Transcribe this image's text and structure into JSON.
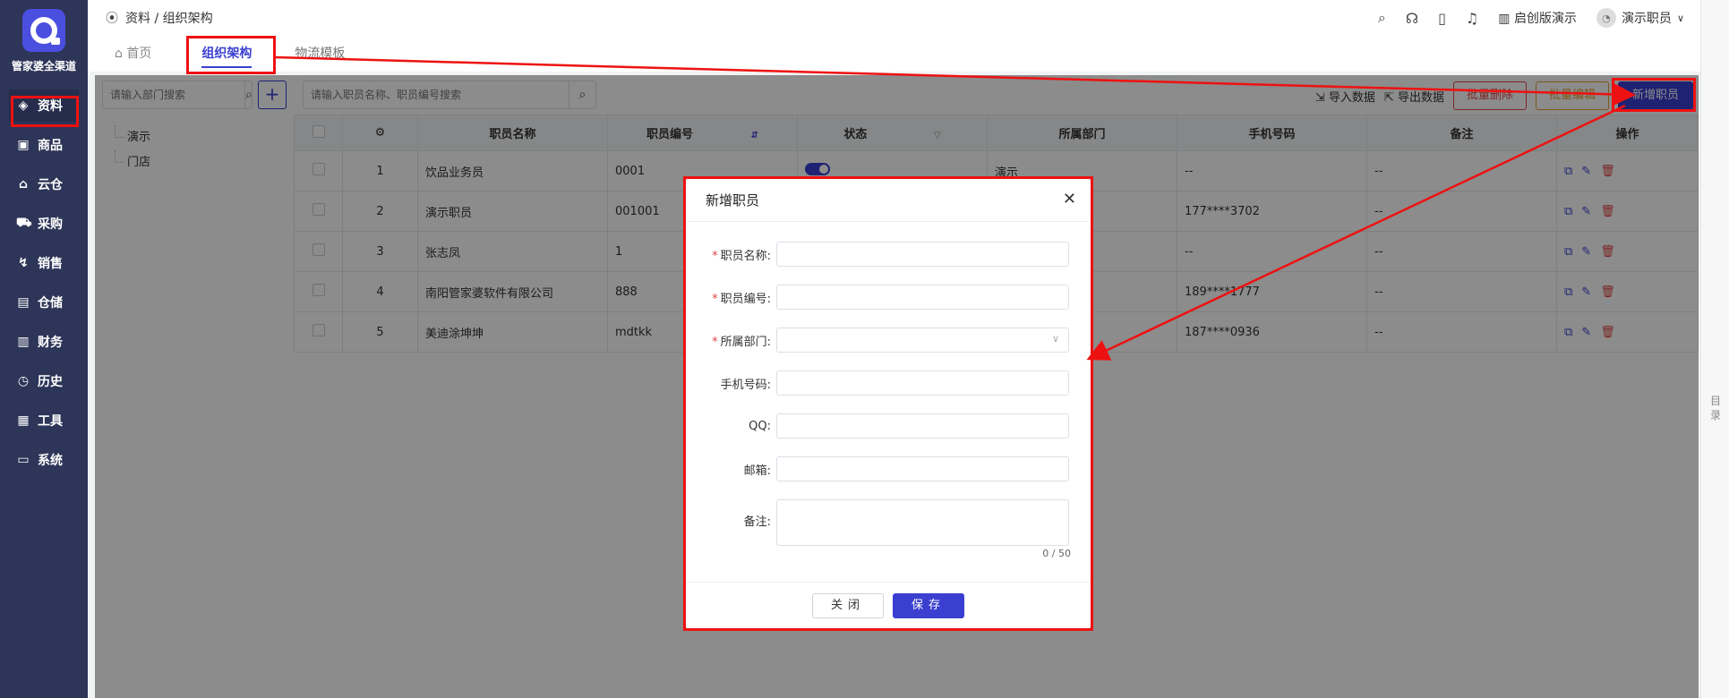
{
  "sidebar": {
    "brand": "管家婆全渠道",
    "items": [
      {
        "label": "资料",
        "icon": "layers-icon",
        "glyph": "◈"
      },
      {
        "label": "商品",
        "icon": "goods-icon",
        "glyph": "▣"
      },
      {
        "label": "云仓",
        "icon": "cloud-warehouse-icon",
        "glyph": "⌂"
      },
      {
        "label": "采购",
        "icon": "cart-icon",
        "glyph": "⛟"
      },
      {
        "label": "销售",
        "icon": "chart-icon",
        "glyph": "↯"
      },
      {
        "label": "仓储",
        "icon": "storage-icon",
        "glyph": "▤"
      },
      {
        "label": "财务",
        "icon": "finance-icon",
        "glyph": "▥"
      },
      {
        "label": "历史",
        "icon": "history-icon",
        "glyph": "◷"
      },
      {
        "label": "工具",
        "icon": "toolbox-icon",
        "glyph": "▦"
      },
      {
        "label": "系统",
        "icon": "monitor-icon",
        "glyph": "▭"
      }
    ]
  },
  "header": {
    "breadcrumb": "资料 / 组织架构",
    "company": "启创版演示",
    "user": "演示职员"
  },
  "tabs": {
    "home": "首页",
    "org": "组织架构",
    "logistics": "物流模板"
  },
  "left": {
    "search_placeholder": "请输入部门搜索",
    "tree": [
      "演示",
      "门店"
    ]
  },
  "main": {
    "search_placeholder": "请输入职员名称、职员编号搜索",
    "import": "导入数据",
    "export": "导出数据",
    "batch_delete": "批量删除",
    "batch_edit": "批量编辑",
    "add_employee": "新增职员"
  },
  "table": {
    "headers": [
      "职员名称",
      "职员编号",
      "状态",
      "所属部门",
      "手机号码",
      "备注",
      "操作"
    ],
    "rows": [
      {
        "no": "1",
        "name": "饮品业务员",
        "code": "0001",
        "dept": "演示",
        "phone": "--",
        "note": "--"
      },
      {
        "no": "2",
        "name": "演示职员",
        "code": "001001",
        "dept": "",
        "phone": "177****3702",
        "note": "--"
      },
      {
        "no": "3",
        "name": "张志凤",
        "code": "1",
        "dept": "",
        "phone": "--",
        "note": "--"
      },
      {
        "no": "4",
        "name": "南阳管家婆软件有限公司",
        "code": "888",
        "dept": "",
        "phone": "189****1777",
        "note": "--"
      },
      {
        "no": "5",
        "name": "美迪涂坤坤",
        "code": "mdtkk",
        "dept": "",
        "phone": "187****0936",
        "note": "--"
      }
    ]
  },
  "modal": {
    "title": "新增职员",
    "fields": {
      "name": "职员名称",
      "code": "职员编号",
      "dept": "所属部门",
      "phone": "手机号码",
      "qq": "QQ",
      "email": "邮箱",
      "note": "备注"
    },
    "counter": "0 / 50",
    "close": "关闭",
    "save": "保存"
  },
  "side_tab": "目录",
  "colors": {
    "primary": "#3a3fd0",
    "sidebar": "#2d3558",
    "danger": "#e04545",
    "annotation": "#e11111"
  }
}
